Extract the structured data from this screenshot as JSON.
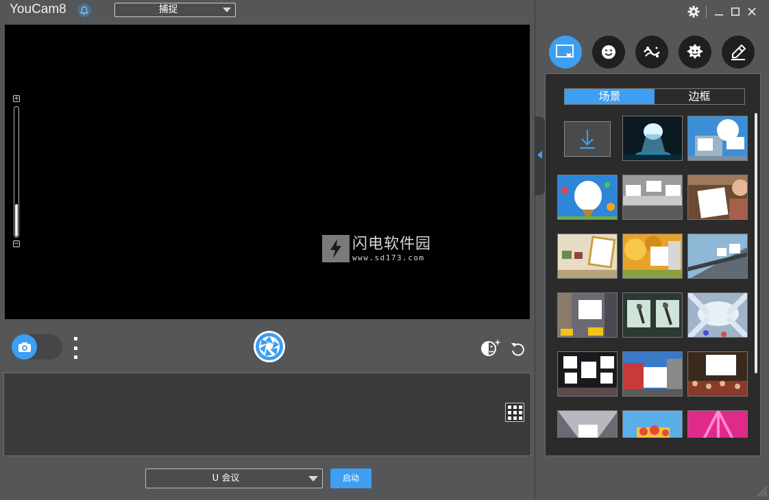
{
  "app": {
    "title": "YouCam8"
  },
  "header": {
    "mode_select": {
      "value": "捕捉"
    }
  },
  "preview": {
    "zoom": {
      "plus": "+",
      "minus": "−",
      "level": 0.25
    },
    "watermark": {
      "line1": "闪电软件园",
      "line2": "www.sd173.com"
    }
  },
  "toolbar": {
    "camera_mode": "photo"
  },
  "bottom": {
    "meeting_select": {
      "value": "U 会议"
    },
    "start_label": "启动"
  },
  "right": {
    "categories": [
      {
        "name": "scene-icon",
        "active": true
      },
      {
        "name": "smile-icon",
        "active": false
      },
      {
        "name": "particle-icon",
        "active": false
      },
      {
        "name": "avatar-icon",
        "active": false
      },
      {
        "name": "brush-icon",
        "active": false
      }
    ],
    "tabs": [
      {
        "label": "场景",
        "active": true
      },
      {
        "label": "边框",
        "active": false
      }
    ]
  },
  "colors": {
    "accent": "#3d9ef2",
    "panel": "#2b2b2c",
    "background": "#555658"
  }
}
